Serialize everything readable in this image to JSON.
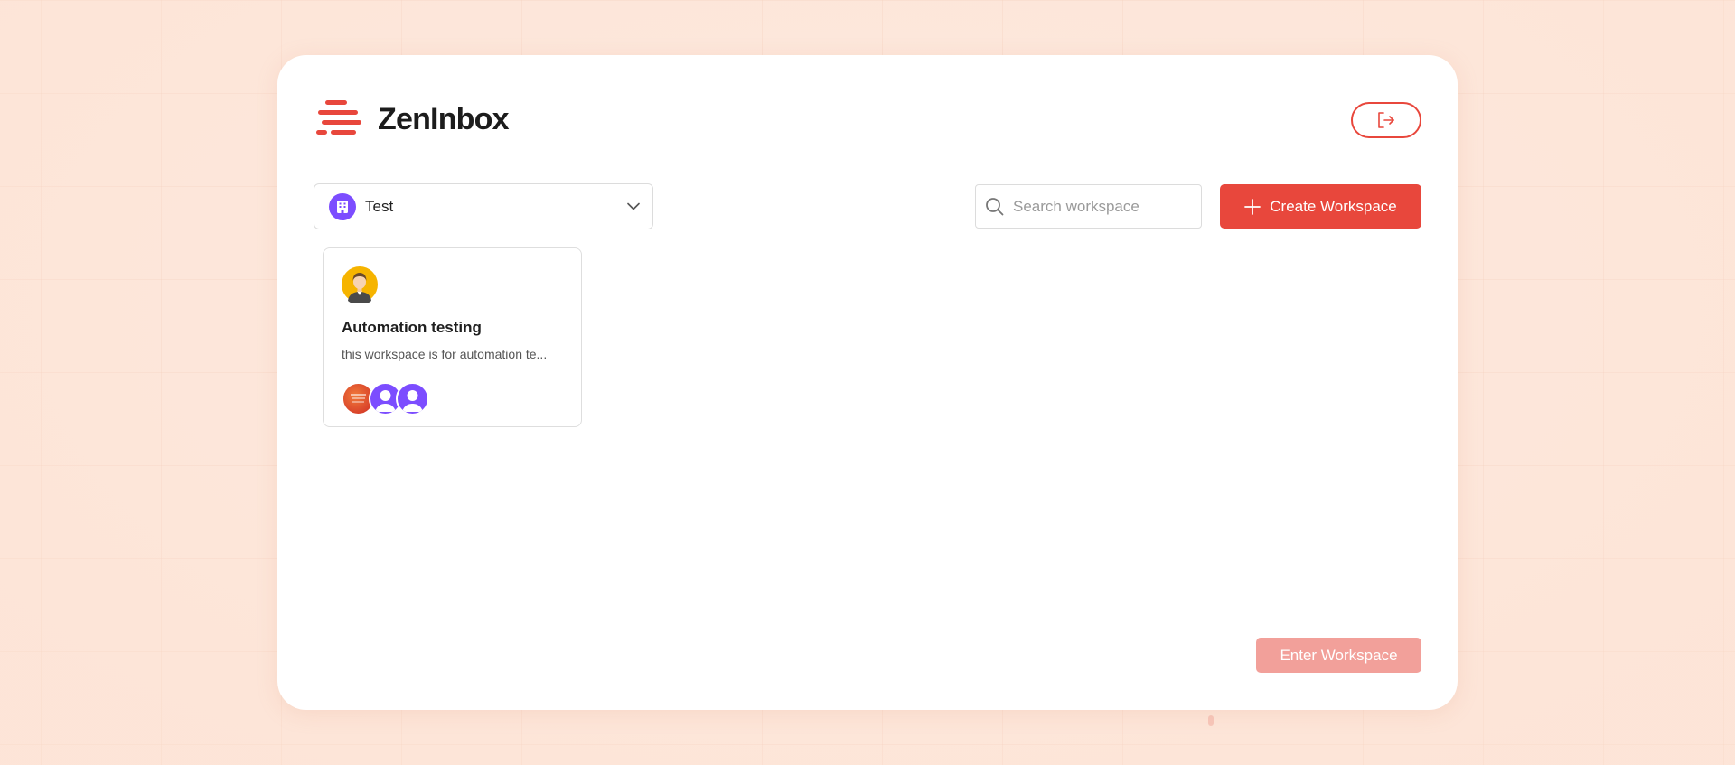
{
  "brand": {
    "name": "ZenInbox",
    "accent_color": "#e8473c"
  },
  "header": {
    "logout_icon": "logout-icon"
  },
  "workspace_selector": {
    "selected": "Test",
    "icon": "building-icon"
  },
  "search": {
    "placeholder": "Search workspace",
    "value": ""
  },
  "create_button": {
    "label": "Create Workspace"
  },
  "workspaces": [
    {
      "title": "Automation testing",
      "description": "this workspace is for automation te...",
      "member_count_shown": 3
    }
  ],
  "enter_button": {
    "label": "Enter Workspace",
    "disabled": true
  }
}
